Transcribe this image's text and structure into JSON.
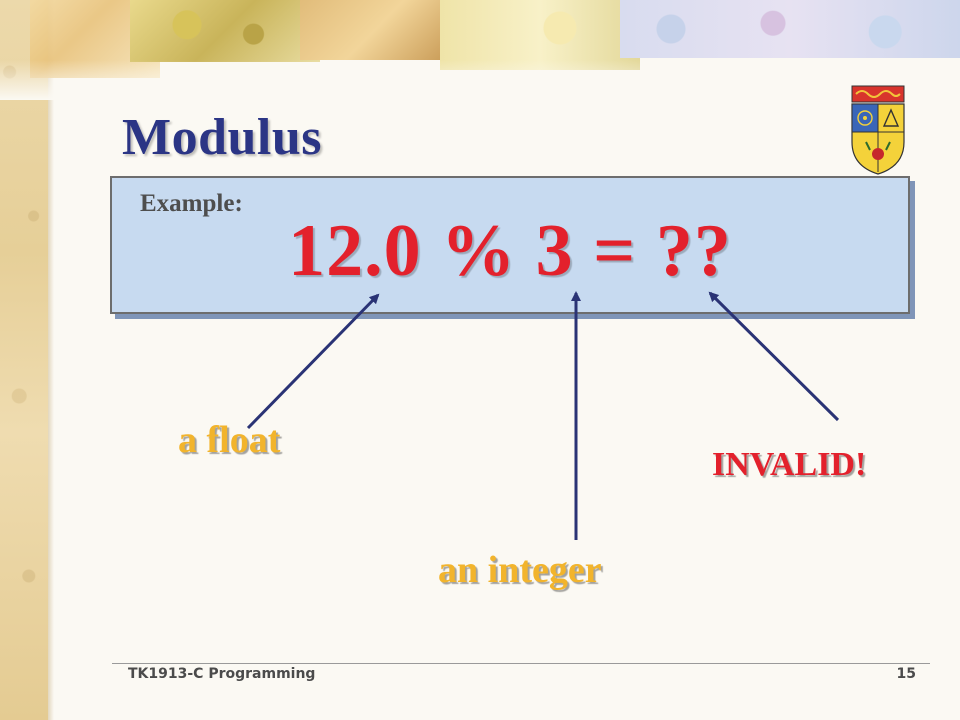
{
  "slide": {
    "title": "Modulus",
    "example_label": "Example:",
    "expression": "12.0 % 3 = ??",
    "annotations": {
      "float_label": "a float",
      "integer_label": "an integer",
      "invalid_label": "INVALID!"
    },
    "footer": {
      "course": "TK1913-C Programming",
      "page_number": "15"
    }
  },
  "colors": {
    "title": "#2b3585",
    "expression": "#e3212c",
    "label_orange": "#f2b42c",
    "label_invalid": "#e3212c",
    "arrow": "#2a3375",
    "box_fill": "#c7daf0"
  },
  "icons": {
    "crest": "university-crest-icon"
  }
}
